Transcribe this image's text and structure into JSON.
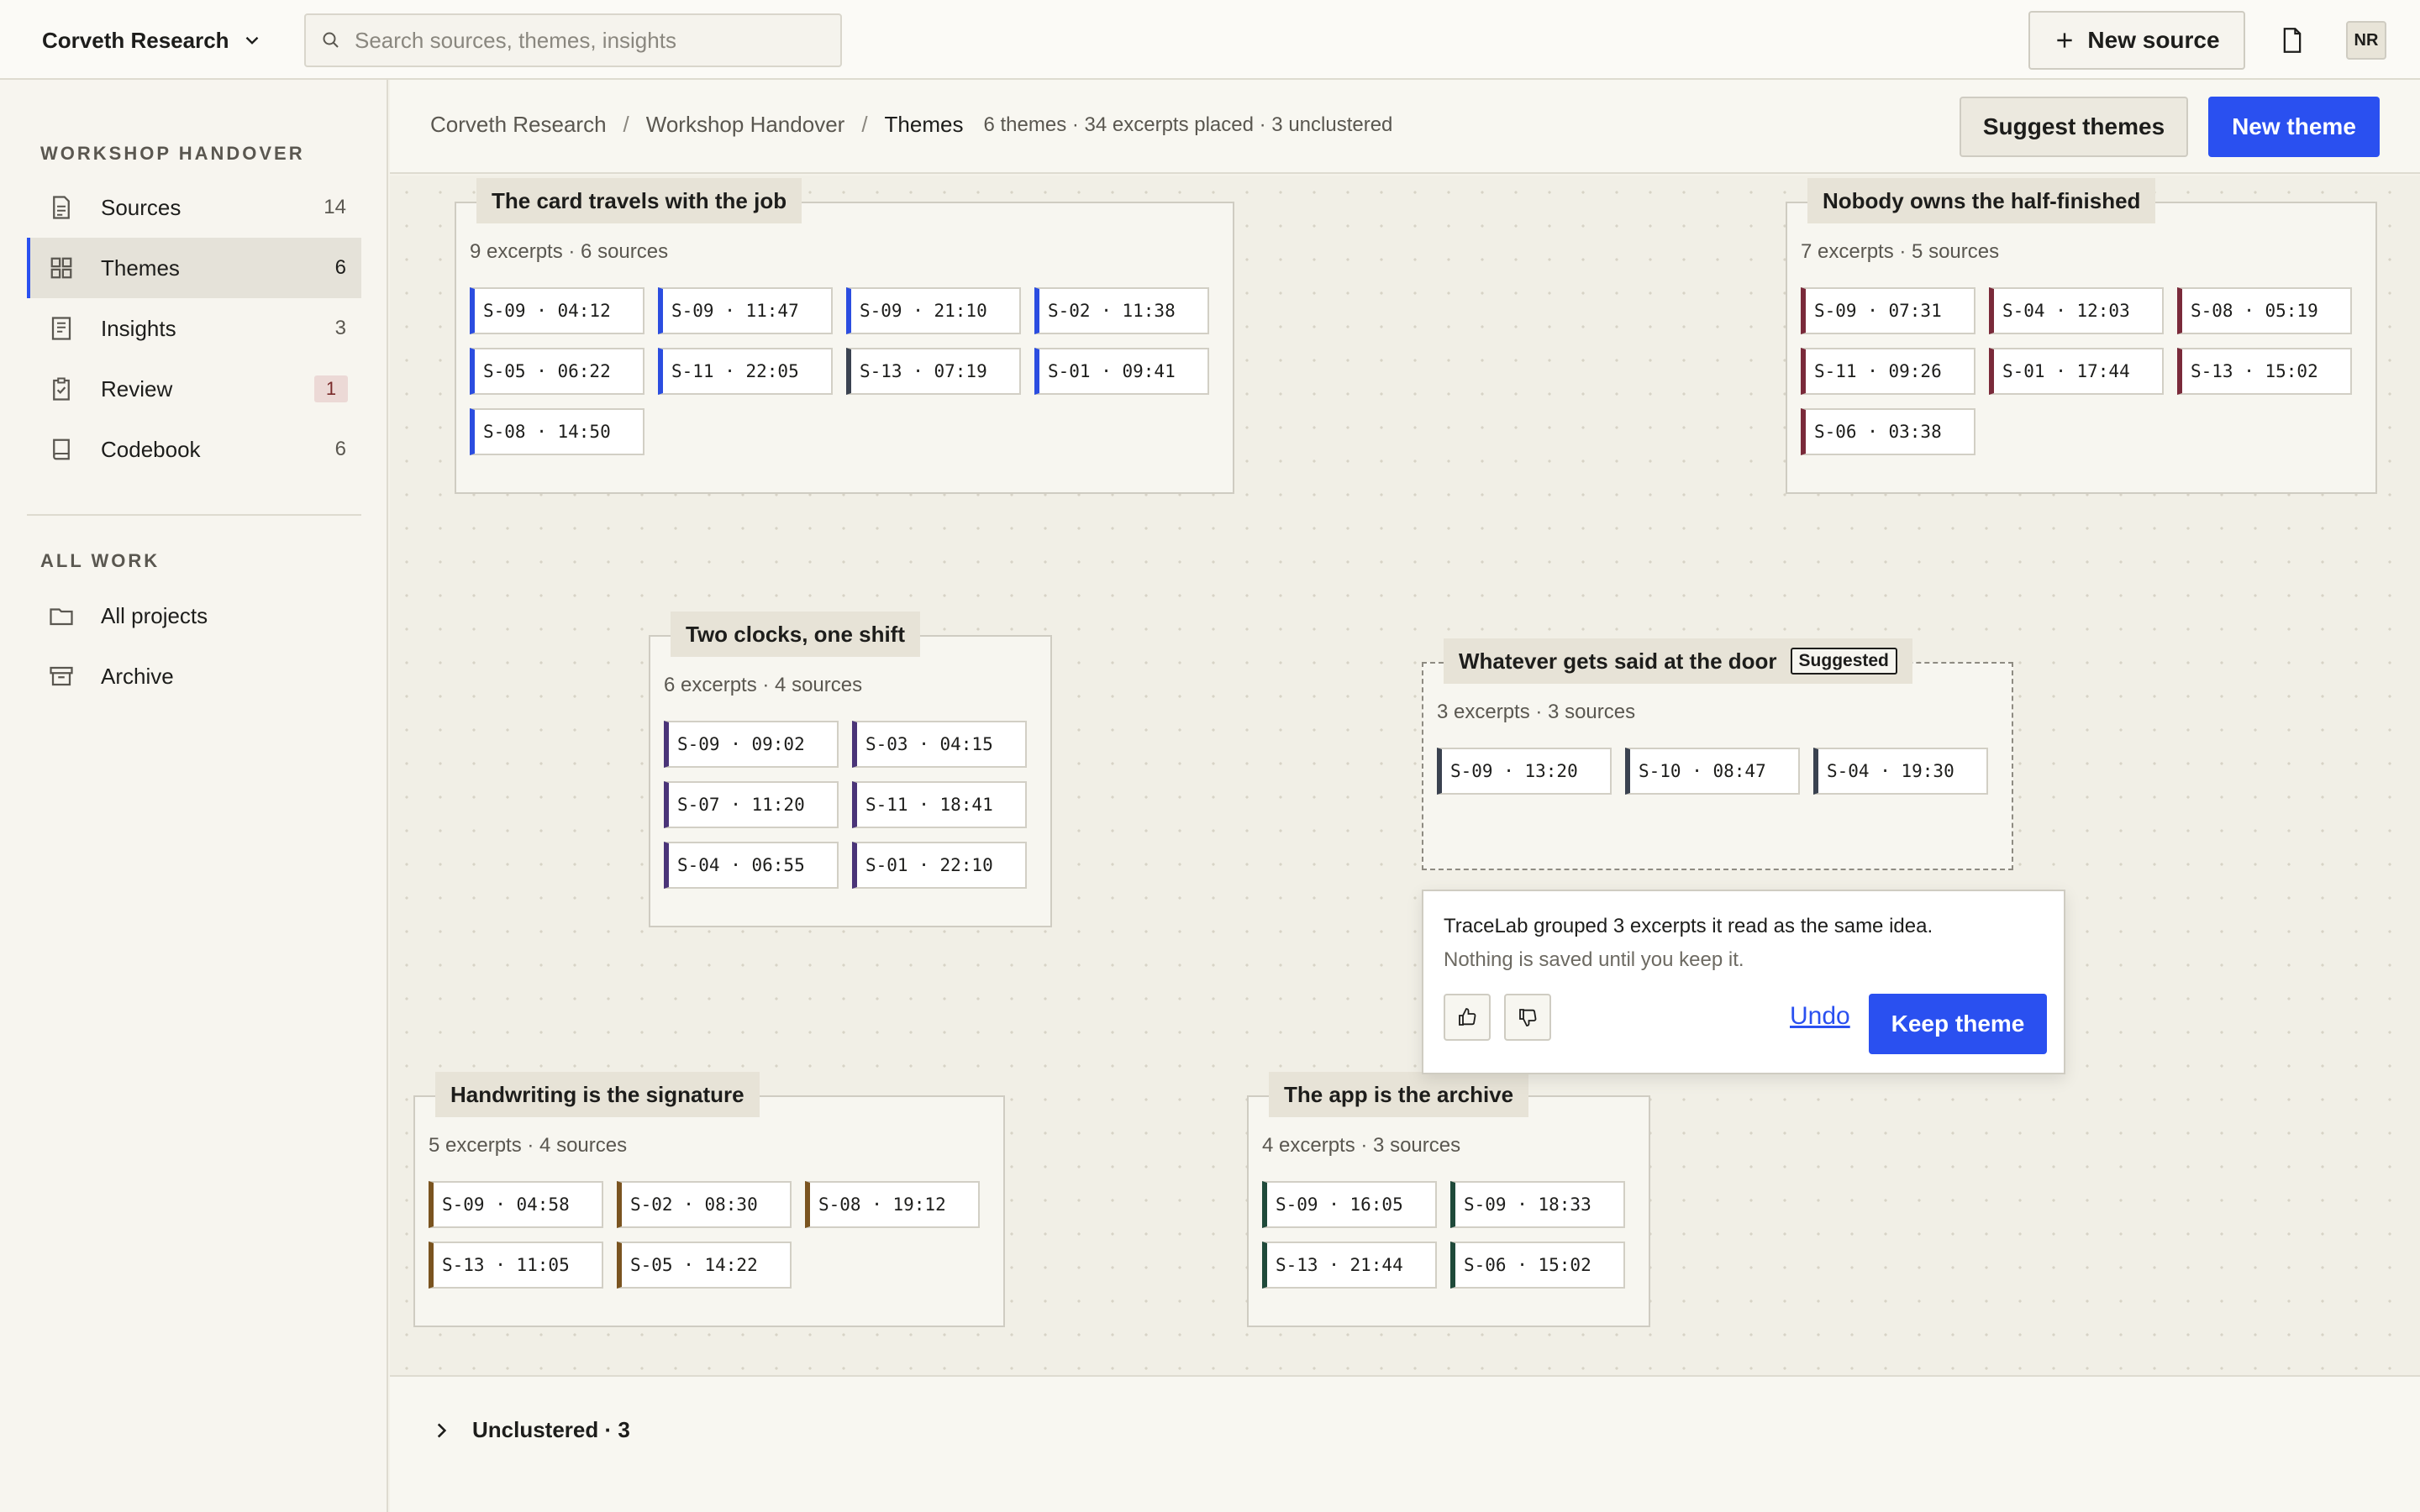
{
  "workspace": {
    "name": "Corveth Research"
  },
  "search": {
    "placeholder": "Search sources, themes, insights"
  },
  "header": {
    "new_source_label": "New source",
    "avatar_initials": "NR"
  },
  "sidebar": {
    "section_project": "WORKSHOP HANDOVER",
    "items": [
      {
        "label": "Sources",
        "count": "14",
        "icon": "document-icon"
      },
      {
        "label": "Themes",
        "count": "6",
        "icon": "grid-icon",
        "active": true
      },
      {
        "label": "Insights",
        "count": "3",
        "icon": "notes-icon"
      },
      {
        "label": "Review",
        "count": "1",
        "icon": "clipboard-check-icon",
        "badge": true
      },
      {
        "label": "Codebook",
        "count": "6",
        "icon": "book-icon"
      }
    ],
    "section_all": "ALL WORK",
    "all_items": [
      {
        "label": "All projects",
        "icon": "folder-icon"
      },
      {
        "label": "Archive",
        "icon": "archive-icon"
      }
    ]
  },
  "breadcrumb": {
    "items": [
      "Corveth Research",
      "Workshop Handover",
      "Themes"
    ],
    "separator": "/",
    "meta": "6 themes · 34 excerpts placed · 3 unclustered"
  },
  "toolbar": {
    "suggest_label": "Suggest themes",
    "new_theme_label": "New theme"
  },
  "themes": [
    {
      "title": "The card travels with the job",
      "meta": "9 excerpts · 6 sources",
      "color": "#2b4de0",
      "excerpts": [
        {
          "label": "S-09 · 04:12"
        },
        {
          "label": "S-09 · 11:47"
        },
        {
          "label": "S-09 · 21:10"
        },
        {
          "label": "S-02 · 11:38"
        },
        {
          "label": "S-05 · 06:22"
        },
        {
          "label": "S-11 · 22:05"
        },
        {
          "label": "S-13 · 07:19",
          "color": "#3a4250"
        },
        {
          "label": "S-01 · 09:41"
        },
        {
          "label": "S-08 · 14:50"
        }
      ]
    },
    {
      "title": "Nobody owns the half-finished",
      "meta": "7 excerpts · 5 sources",
      "color": "#7a2a3a",
      "excerpts": [
        {
          "label": "S-09 · 07:31"
        },
        {
          "label": "S-04 · 12:03"
        },
        {
          "label": "S-08 · 05:19"
        },
        {
          "label": "S-11 · 09:26"
        },
        {
          "label": "S-01 · 17:44"
        },
        {
          "label": "S-13 · 15:02"
        },
        {
          "label": "S-06 · 03:38"
        }
      ]
    },
    {
      "title": "Two clocks, one shift",
      "meta": "6 excerpts · 4 sources",
      "color": "#4a3478",
      "excerpts": [
        {
          "label": "S-09 · 09:02"
        },
        {
          "label": "S-03 · 04:15"
        },
        {
          "label": "S-07 · 11:20"
        },
        {
          "label": "S-11 · 18:41"
        },
        {
          "label": "S-04 · 06:55"
        },
        {
          "label": "S-01 · 22:10"
        }
      ]
    },
    {
      "title": "Whatever gets said at the door",
      "tag": "Suggested",
      "meta": "3 excerpts · 3 sources",
      "color": "#3a4250",
      "excerpts": [
        {
          "label": "S-09 · 13:20"
        },
        {
          "label": "S-10 · 08:47"
        },
        {
          "label": "S-04 · 19:30"
        }
      ]
    },
    {
      "title": "Handwriting is the signature",
      "meta": "5 excerpts · 4 sources",
      "color": "#7a5420",
      "excerpts": [
        {
          "label": "S-09 · 04:58"
        },
        {
          "label": "S-02 · 08:30"
        },
        {
          "label": "S-08 · 19:12"
        },
        {
          "label": "S-13 · 11:05"
        },
        {
          "label": "S-05 · 14:22"
        }
      ]
    },
    {
      "title": "The app is the archive",
      "meta": "4 excerpts · 3 sources",
      "color": "#1f4a3a",
      "excerpts": [
        {
          "label": "S-09 · 16:05"
        },
        {
          "label": "S-09 · 18:33"
        },
        {
          "label": "S-13 · 21:44"
        },
        {
          "label": "S-06 · 15:02"
        }
      ]
    }
  ],
  "suggestion_popover": {
    "message": "TraceLab grouped 3 excerpts it read as the same idea.",
    "subtext": "Nothing is saved until you keep it.",
    "undo_label": "Undo",
    "keep_label": "Keep theme"
  },
  "unclustered": {
    "label": "Unclustered · 3"
  },
  "colors": {
    "accent": "#2a50f0",
    "background": "#f4f2ea",
    "review_badge": "#ecd9d6"
  }
}
